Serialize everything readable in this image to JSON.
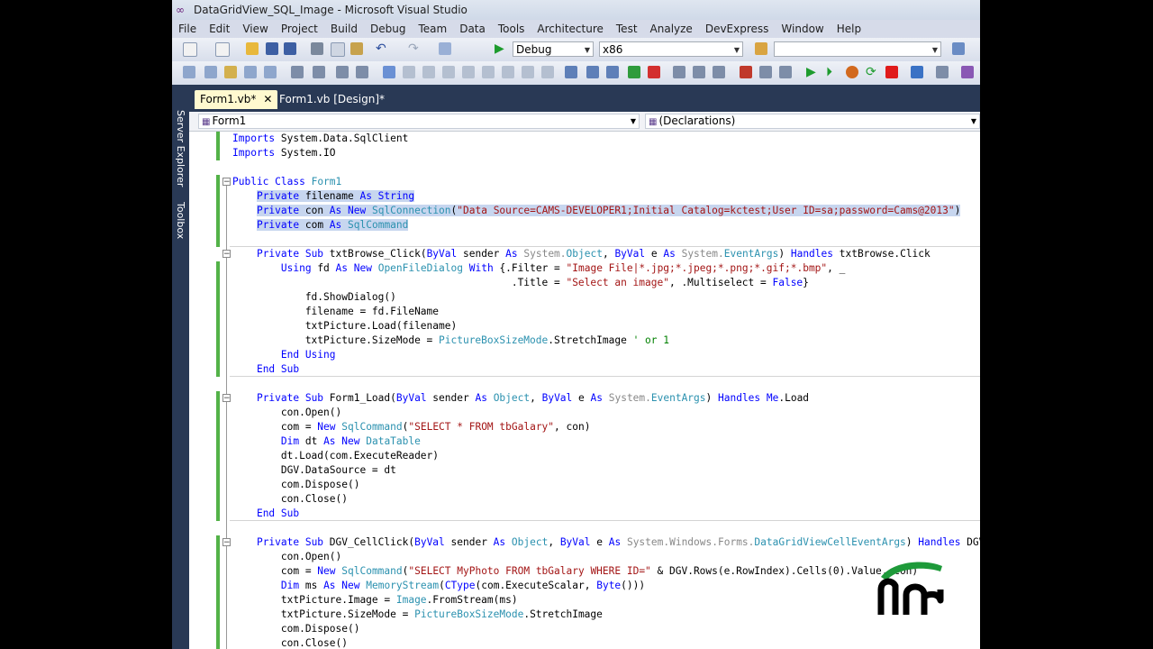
{
  "window": {
    "title": "DataGridView_SQL_Image - Microsoft Visual Studio"
  },
  "menu": [
    "File",
    "Edit",
    "View",
    "Project",
    "Build",
    "Debug",
    "Team",
    "Data",
    "Tools",
    "Architecture",
    "Test",
    "Analyze",
    "DevExpress",
    "Window",
    "Help"
  ],
  "toolbar": {
    "config": "Debug",
    "platform": "x86",
    "search": ""
  },
  "sidebar": {
    "server_explorer": "Server Explorer",
    "toolbox": "Toolbox"
  },
  "tabs": [
    {
      "label": "Form1.vb*"
    },
    {
      "label": "Form1.vb [Design]*"
    }
  ],
  "nav": {
    "left": "Form1",
    "right": "(Declarations)"
  },
  "code": [
    [
      [
        "kw",
        "Imports"
      ],
      [
        "p",
        " System.Data.SqlClient"
      ]
    ],
    [
      [
        "kw",
        "Imports"
      ],
      [
        "p",
        " System.IO"
      ]
    ],
    [],
    [
      [
        "kw",
        "Public Class"
      ],
      [
        "p",
        " "
      ],
      [
        "ty",
        "Form1"
      ]
    ],
    [
      [
        "p",
        "    "
      ],
      [
        "kw",
        "Private"
      ],
      [
        "p",
        " filename "
      ],
      [
        "kw",
        "As String"
      ]
    ],
    [
      [
        "p",
        "    "
      ],
      [
        "kw",
        "Private"
      ],
      [
        "p",
        " con "
      ],
      [
        "kw",
        "As New"
      ],
      [
        "p",
        " "
      ],
      [
        "ty",
        "SqlConnection"
      ],
      [
        "p",
        "("
      ],
      [
        "st",
        "\"Data Source=CAMS-DEVELOPER1;Initial Catalog=kctest;User ID=sa;password=Cams@2013\""
      ],
      [
        "p",
        ")"
      ]
    ],
    [
      [
        "p",
        "    "
      ],
      [
        "kw",
        "Private"
      ],
      [
        "p",
        " com "
      ],
      [
        "kw",
        "As"
      ],
      [
        "p",
        " "
      ],
      [
        "ty",
        "SqlCommand"
      ]
    ],
    [],
    [
      [
        "p",
        "    "
      ],
      [
        "kw",
        "Private Sub"
      ],
      [
        "p",
        " txtBrowse_Click("
      ],
      [
        "kw",
        "ByVal"
      ],
      [
        "p",
        " sender "
      ],
      [
        "kw",
        "As"
      ],
      [
        "p",
        " "
      ],
      [
        "sys",
        "System."
      ],
      [
        "ty",
        "Object"
      ],
      [
        "p",
        ", "
      ],
      [
        "kw",
        "ByVal"
      ],
      [
        "p",
        " e "
      ],
      [
        "kw",
        "As"
      ],
      [
        "p",
        " "
      ],
      [
        "sys",
        "System."
      ],
      [
        "ty",
        "EventArgs"
      ],
      [
        "p",
        ") "
      ],
      [
        "kw",
        "Handles"
      ],
      [
        "p",
        " txtBrowse.Click"
      ]
    ],
    [
      [
        "p",
        "        "
      ],
      [
        "kw",
        "Using"
      ],
      [
        "p",
        " fd "
      ],
      [
        "kw",
        "As New"
      ],
      [
        "p",
        " "
      ],
      [
        "ty",
        "OpenFileDialog"
      ],
      [
        "p",
        " "
      ],
      [
        "kw",
        "With"
      ],
      [
        "p",
        " {.Filter = "
      ],
      [
        "st",
        "\"Image File|*.jpg;*.jpeg;*.png;*.gif;*.bmp\""
      ],
      [
        "p",
        ", _"
      ]
    ],
    [
      [
        "p",
        "                                              .Title = "
      ],
      [
        "st",
        "\"Select an image\""
      ],
      [
        "p",
        ", .Multiselect = "
      ],
      [
        "kw",
        "False"
      ],
      [
        "p",
        "}"
      ]
    ],
    [
      [
        "p",
        "            fd.ShowDialog()"
      ]
    ],
    [
      [
        "p",
        "            filename = fd.FileName"
      ]
    ],
    [
      [
        "p",
        "            txtPicture.Load(filename)"
      ]
    ],
    [
      [
        "p",
        "            txtPicture.SizeMode = "
      ],
      [
        "ty",
        "PictureBoxSizeMode"
      ],
      [
        "p",
        ".StretchImage "
      ],
      [
        "cm",
        "' or 1"
      ]
    ],
    [
      [
        "p",
        "        "
      ],
      [
        "kw",
        "End Using"
      ]
    ],
    [
      [
        "p",
        "    "
      ],
      [
        "kw",
        "End Sub"
      ]
    ],
    [],
    [
      [
        "p",
        "    "
      ],
      [
        "kw",
        "Private Sub"
      ],
      [
        "p",
        " Form1_Load("
      ],
      [
        "kw",
        "ByVal"
      ],
      [
        "p",
        " sender "
      ],
      [
        "kw",
        "As"
      ],
      [
        "p",
        " "
      ],
      [
        "ty",
        "Object"
      ],
      [
        "p",
        ", "
      ],
      [
        "kw",
        "ByVal"
      ],
      [
        "p",
        " e "
      ],
      [
        "kw",
        "As"
      ],
      [
        "p",
        " "
      ],
      [
        "sys",
        "System."
      ],
      [
        "ty",
        "EventArgs"
      ],
      [
        "p",
        ") "
      ],
      [
        "kw",
        "Handles Me"
      ],
      [
        "p",
        ".Load"
      ]
    ],
    [
      [
        "p",
        "        con.Open()"
      ]
    ],
    [
      [
        "p",
        "        com = "
      ],
      [
        "kw",
        "New"
      ],
      [
        "p",
        " "
      ],
      [
        "ty",
        "SqlCommand"
      ],
      [
        "p",
        "("
      ],
      [
        "st",
        "\"SELECT * FROM tbGalary\""
      ],
      [
        "p",
        ", con)"
      ]
    ],
    [
      [
        "p",
        "        "
      ],
      [
        "kw",
        "Dim"
      ],
      [
        "p",
        " dt "
      ],
      [
        "kw",
        "As New"
      ],
      [
        "p",
        " "
      ],
      [
        "ty",
        "DataTable"
      ]
    ],
    [
      [
        "p",
        "        dt.Load(com.ExecuteReader)"
      ]
    ],
    [
      [
        "p",
        "        DGV.DataSource = dt"
      ]
    ],
    [
      [
        "p",
        "        com.Dispose()"
      ]
    ],
    [
      [
        "p",
        "        con.Close()"
      ]
    ],
    [
      [
        "p",
        "    "
      ],
      [
        "kw",
        "End Sub"
      ]
    ],
    [],
    [
      [
        "p",
        "    "
      ],
      [
        "kw",
        "Private Sub"
      ],
      [
        "p",
        " DGV_CellClick("
      ],
      [
        "kw",
        "ByVal"
      ],
      [
        "p",
        " sender "
      ],
      [
        "kw",
        "As"
      ],
      [
        "p",
        " "
      ],
      [
        "ty",
        "Object"
      ],
      [
        "p",
        ", "
      ],
      [
        "kw",
        "ByVal"
      ],
      [
        "p",
        " e "
      ],
      [
        "kw",
        "As"
      ],
      [
        "p",
        " "
      ],
      [
        "sys",
        "System.Windows.Forms."
      ],
      [
        "ty",
        "DataGridViewCellEventArgs"
      ],
      [
        "p",
        ") "
      ],
      [
        "kw",
        "Handles"
      ],
      [
        "p",
        " DGV.CellClick"
      ]
    ],
    [
      [
        "p",
        "        con.Open()"
      ]
    ],
    [
      [
        "p",
        "        com = "
      ],
      [
        "kw",
        "New"
      ],
      [
        "p",
        " "
      ],
      [
        "ty",
        "SqlCommand"
      ],
      [
        "p",
        "("
      ],
      [
        "st",
        "\"SELECT MyPhoto FROM tbGalary WHERE ID=\""
      ],
      [
        "p",
        " & DGV.Rows(e.RowIndex).Cells(0).Value, con)"
      ]
    ],
    [
      [
        "p",
        "        "
      ],
      [
        "kw",
        "Dim"
      ],
      [
        "p",
        " ms "
      ],
      [
        "kw",
        "As New"
      ],
      [
        "p",
        " "
      ],
      [
        "ty",
        "MemoryStream"
      ],
      [
        "p",
        "("
      ],
      [
        "kw",
        "CType"
      ],
      [
        "p",
        "(com.ExecuteScalar, "
      ],
      [
        "kw",
        "Byte"
      ],
      [
        "p",
        "()))"
      ]
    ],
    [
      [
        "p",
        "        txtPicture.Image = "
      ],
      [
        "ty",
        "Image"
      ],
      [
        "p",
        ".FromStream(ms)"
      ]
    ],
    [
      [
        "p",
        "        txtPicture.SizeMode = "
      ],
      [
        "ty",
        "PictureBoxSizeMode"
      ],
      [
        "p",
        ".StretchImage"
      ]
    ],
    [
      [
        "p",
        "        com.Dispose()"
      ]
    ],
    [
      [
        "p",
        "        con.Close()"
      ]
    ]
  ],
  "colors": {
    "title_bg": "#cfd9e8",
    "menu_bg": "#d6dbe9",
    "dark_bg": "#293955",
    "active_tab": "#fff9cf",
    "keyword": "#0000ff",
    "type": "#2b91af",
    "string": "#a31515",
    "comment": "#008000",
    "selection": "#c7d6ef",
    "changed_bar": "#53b248"
  }
}
